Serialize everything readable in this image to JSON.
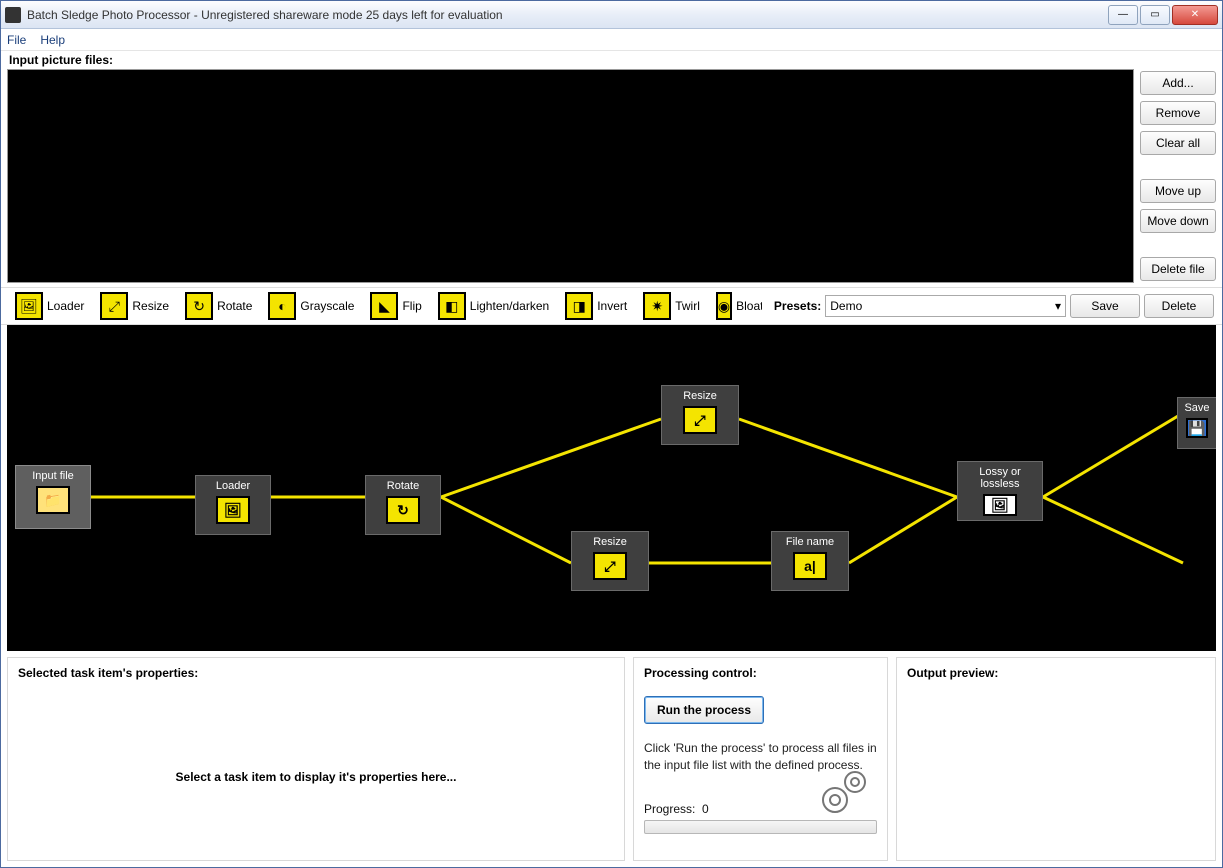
{
  "window": {
    "title": "Batch Sledge Photo Processor - Unregistered shareware mode 25 days left for evaluation"
  },
  "menubar": {
    "file": "File",
    "help": "Help"
  },
  "input_section": {
    "label": "Input picture files:",
    "buttons": {
      "add": "Add...",
      "remove": "Remove",
      "clear": "Clear all",
      "move_up": "Move up",
      "move_down": "Move down",
      "delete_file": "Delete file"
    }
  },
  "toolbar": {
    "items": [
      {
        "name": "loader",
        "label": "Loader"
      },
      {
        "name": "resize",
        "label": "Resize"
      },
      {
        "name": "rotate",
        "label": "Rotate"
      },
      {
        "name": "grayscale",
        "label": "Grayscale"
      },
      {
        "name": "flip",
        "label": "Flip"
      },
      {
        "name": "lighten",
        "label": "Lighten/darken"
      },
      {
        "name": "invert",
        "label": "Invert"
      },
      {
        "name": "twirl",
        "label": "Twirl"
      },
      {
        "name": "bloat",
        "label": "Bloat"
      }
    ],
    "presets_label": "Presets:",
    "presets_value": "Demo",
    "save": "Save",
    "delete": "Delete"
  },
  "graph": {
    "nodes": {
      "input": "Input file",
      "loader": "Loader",
      "rotate": "Rotate",
      "resize1": "Resize",
      "resize2": "Resize",
      "filename": "File name",
      "lossy": "Lossy or lossless",
      "save": "Save"
    }
  },
  "panels": {
    "props_title": "Selected task item's properties:",
    "props_placeholder": "Select a task item to display it's properties here...",
    "ctrl_title": "Processing control:",
    "run_button": "Run the process",
    "ctrl_help": "Click 'Run the process' to process all files in the input file list with the defined process.",
    "progress_label": "Progress:",
    "progress_value": "0",
    "preview_title": "Output preview:"
  }
}
